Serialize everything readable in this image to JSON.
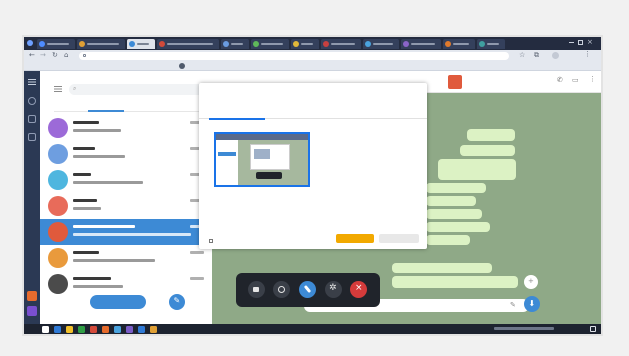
{
  "browser": {
    "tabs": [
      {
        "label": "",
        "color": "#4e8cff"
      },
      {
        "label": "",
        "color": "#e0a035"
      },
      {
        "label": "",
        "color": "#3d8ad5"
      },
      {
        "label": "",
        "color": "#d24a3a"
      },
      {
        "label": "",
        "color": "#6a9be0"
      },
      {
        "label": "",
        "color": "#5fb85a"
      },
      {
        "label": "",
        "color": "#e0b83a"
      },
      {
        "label": "",
        "color": "#c74040"
      },
      {
        "label": "",
        "color": "#4aa3df"
      },
      {
        "label": "",
        "color": "#8a64c8"
      },
      {
        "label": "",
        "color": "#e07a2c"
      },
      {
        "label": "",
        "color": "#3fa0a0"
      }
    ],
    "active_tab_index": 2,
    "url": "",
    "page_title": "",
    "bookmarks": ""
  },
  "telegram": {
    "search_placeholder": "",
    "folders": [
      "",
      "",
      "",
      ""
    ],
    "chats": [
      {
        "name": "",
        "preview": "",
        "time": "",
        "avatar_color": "#9c6ad8"
      },
      {
        "name": "",
        "preview": "",
        "time": "",
        "avatar_color": "#6e9ee0"
      },
      {
        "name": "",
        "preview": "",
        "time": "",
        "avatar_color": "#4eb6df"
      },
      {
        "name": "",
        "preview": "",
        "time": "",
        "avatar_color": "#e86b5a"
      },
      {
        "name": "",
        "preview": "",
        "time": "",
        "avatar_color": "#e05a3c",
        "selected": true
      },
      {
        "name": "",
        "preview": "",
        "time": "",
        "avatar_color": "#e99a3c"
      },
      {
        "name": "",
        "preview": "",
        "time": "",
        "avatar_color": "#4b4b4b"
      }
    ],
    "compose_button_label": "",
    "chat_header": {
      "title": "",
      "subtitle": ""
    }
  },
  "share_dialog": {
    "title": "",
    "subtitle": "",
    "tabs": [
      "",
      "",
      ""
    ],
    "active_tab_index": 0,
    "checkbox_label": "",
    "share_button": "",
    "cancel_button": "",
    "accent_color": "#1a73e8",
    "share_color": "#f2a900"
  },
  "call_controls": {
    "buttons": [
      "camera-icon",
      "screen-share-icon",
      "microphone-icon",
      "settings-icon",
      "end-call-icon"
    ],
    "active_color": "#3d8ad5",
    "end_color": "#d43b3b"
  },
  "taskbar": {
    "clock": "",
    "apps": [
      "#ffffff",
      "#2f7ad6",
      "#f2c02a",
      "#2f9e44",
      "#d34a3a",
      "#e66b2c",
      "#4aa3df",
      "#7a5cc8",
      "#2f7ad6",
      "#e0a035"
    ]
  }
}
